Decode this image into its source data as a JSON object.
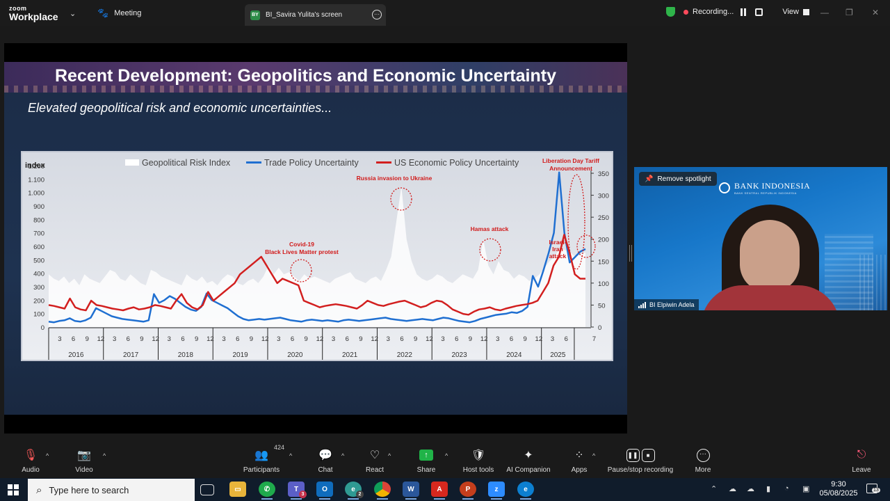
{
  "topbar": {
    "logo_line1": "zoom",
    "logo_line2": "Workplace",
    "meeting_label": "Meeting",
    "share_tab_initials": "BY",
    "share_tab_label": "BI_Savira Yulita's screen",
    "recording_label": "Recording...",
    "view_label": "View"
  },
  "slide": {
    "title": "Recent Development: Geopolitics and Economic Uncertainty",
    "subtitle": "Elevated geopolitical risk and economic uncertainties..."
  },
  "chart_data": {
    "type": "area",
    "ylabel": "index",
    "legend": [
      "Geopolitical Risk Index",
      "Trade Policy Uncertainty",
      "US Economic Policy Uncertainty"
    ],
    "left_axis_ticks": [
      "0",
      "100",
      "200",
      "300",
      "400",
      "500",
      "600",
      "700",
      "800",
      "900",
      "1.000",
      "1.100",
      "1.200"
    ],
    "right_axis_ticks": [
      "0",
      "50",
      "100",
      "150",
      "200",
      "250",
      "300",
      "350"
    ],
    "ylim_left": [
      0,
      1200
    ],
    "ylim_right": [
      0,
      350
    ],
    "months": [
      "3",
      "6",
      "9",
      "12"
    ],
    "months_2025": [
      "3",
      "6",
      "7"
    ],
    "years": [
      "2016",
      "2017",
      "2018",
      "2019",
      "2020",
      "2021",
      "2022",
      "2023",
      "2024",
      "2025"
    ],
    "annotations": {
      "covid": [
        "Covid-19",
        "Black Lives Matter protest"
      ],
      "russia": "Russia invasion to Ukraine",
      "hamas": "Hamas attack",
      "liberation": [
        "Liberation Day Tariff",
        "Announcement"
      ],
      "israel": [
        "Israel-",
        "Iran",
        "attack"
      ]
    },
    "series": [
      {
        "name": "Geopolitical Risk Index",
        "axis": "right",
        "color": "#ffffff",
        "values": [
          120,
          110,
          105,
          115,
          100,
          110,
          95,
          120,
          110,
          105,
          100,
          115,
          130,
          125,
          110,
          105,
          120,
          110,
          100,
          95,
          130,
          125,
          115,
          110,
          105,
          100,
          95,
          120,
          110,
          105,
          115,
          100,
          105,
          95,
          110,
          120,
          115,
          100,
          95,
          105,
          110,
          100,
          115,
          140,
          120,
          135,
          120,
          125,
          115,
          105,
          120,
          110,
          115,
          110,
          105,
          100,
          110,
          115,
          120,
          125,
          110,
          105,
          100,
          110,
          115,
          105,
          130,
          160,
          240,
          320,
          200,
          150,
          120,
          110,
          105,
          110,
          120,
          115,
          105,
          100,
          110,
          120,
          115,
          110,
          130,
          200,
          140,
          120,
          150,
          130,
          125,
          110,
          120,
          115,
          105,
          110,
          120,
          135,
          150,
          160,
          180,
          175,
          170,
          160,
          165,
          170
        ]
      },
      {
        "name": "Trade Policy Uncertainty",
        "axis": "left",
        "color": "#1f6fd1",
        "values": [
          40,
          35,
          45,
          50,
          65,
          45,
          40,
          50,
          70,
          140,
          120,
          100,
          80,
          70,
          60,
          55,
          50,
          45,
          40,
          50,
          245,
          180,
          200,
          230,
          210,
          180,
          150,
          130,
          120,
          150,
          250,
          200,
          180,
          160,
          140,
          110,
          80,
          60,
          50,
          55,
          60,
          55,
          60,
          65,
          70,
          60,
          50,
          45,
          40,
          50,
          55,
          50,
          45,
          50,
          45,
          40,
          50,
          55,
          50,
          45,
          50,
          55,
          60,
          65,
          70,
          60,
          55,
          50,
          45,
          50,
          55,
          60,
          55,
          50,
          60,
          70,
          65,
          55,
          45,
          40,
          35,
          45,
          60,
          70,
          80,
          90,
          95,
          100,
          110,
          105,
          120,
          150,
          380,
          300,
          420,
          550,
          700,
          1150,
          700,
          480,
          520,
          560,
          580
        ]
      },
      {
        "name": "US Economic Policy Uncertainty",
        "axis": "right",
        "color": "#d21f1f",
        "values": [
          50,
          48,
          45,
          42,
          65,
          45,
          40,
          38,
          60,
          50,
          48,
          45,
          42,
          40,
          38,
          42,
          45,
          40,
          42,
          45,
          50,
          48,
          45,
          42,
          60,
          75,
          55,
          45,
          40,
          50,
          80,
          60,
          70,
          80,
          90,
          100,
          120,
          130,
          140,
          150,
          160,
          140,
          120,
          100,
          110,
          105,
          100,
          95,
          60,
          55,
          50,
          45,
          48,
          50,
          52,
          50,
          48,
          45,
          42,
          50,
          60,
          55,
          50,
          48,
          52,
          55,
          58,
          60,
          55,
          50,
          45,
          48,
          55,
          60,
          58,
          50,
          40,
          35,
          30,
          28,
          35,
          40,
          42,
          45,
          40,
          38,
          42,
          45,
          48,
          50,
          52,
          55,
          60,
          80,
          100,
          140,
          160,
          210,
          170,
          120,
          110,
          110
        ]
      }
    ]
  },
  "video": {
    "spotlight_label": "Remove spotlight",
    "bank_name": "BANK INDONESIA",
    "bank_sub": "BANK SENTRAL REPUBLIK INDONESIA",
    "participant_name": "BI Elpiwin Adela"
  },
  "toolbar": {
    "audio": "Audio",
    "video": "Video",
    "participants": "Participants",
    "participants_count": "424",
    "chat": "Chat",
    "react": "React",
    "share": "Share",
    "host_tools": "Host tools",
    "ai_companion": "AI Companion",
    "apps": "Apps",
    "pause_stop": "Pause/stop recording",
    "more": "More",
    "leave": "Leave"
  },
  "taskbar": {
    "search_placeholder": "Type here to search",
    "teams_badge": "3",
    "edge_badge": "2",
    "time": "9:30",
    "date": "05/08/2025",
    "notification_count": "13"
  }
}
